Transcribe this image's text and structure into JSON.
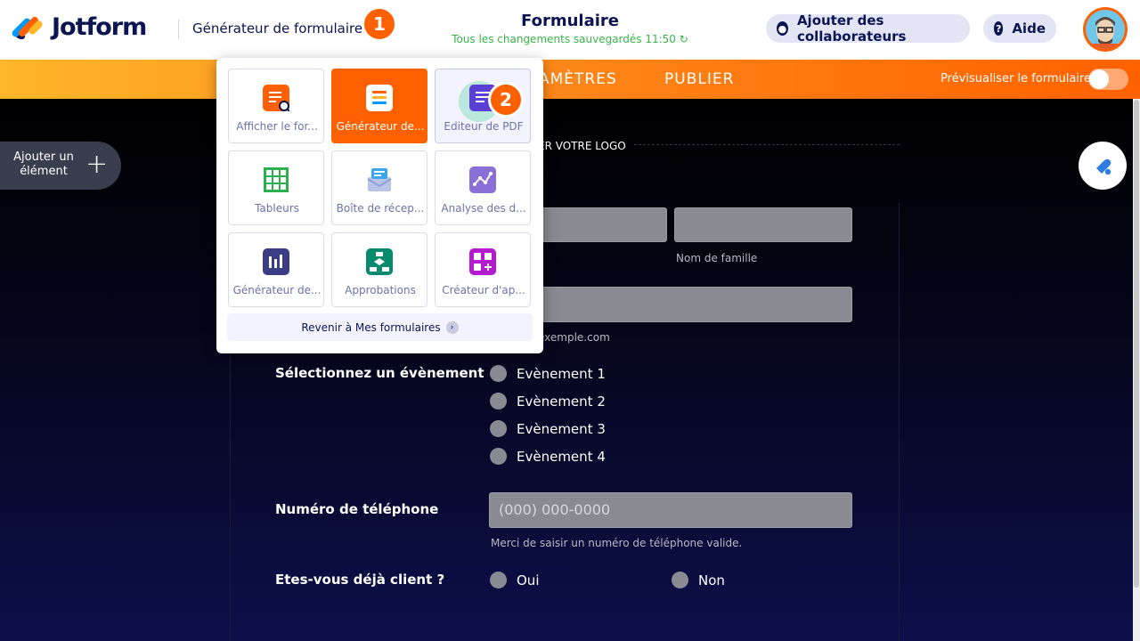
{
  "header": {
    "brand": "Jotform",
    "builder_menu": "Générateur de formulaires",
    "step1": "1",
    "form_title": "Formulaire",
    "save_status": "Tous les changements sauvegardés 11:50 ↻",
    "collaborators": "Ajouter des collaborateurs",
    "help": "Aide"
  },
  "nav": {
    "settings": "AMÈTRES",
    "publish": "PUBLIER",
    "preview": "Prévisualiser le formulaire"
  },
  "dropdown": {
    "tiles": [
      {
        "label": "Afficher le for...",
        "icon": "form-view-icon",
        "color": "#ff6100"
      },
      {
        "label": "Générateur de...",
        "icon": "form-builder-icon",
        "color": "#ff6100"
      },
      {
        "label": "Editeur de PDF",
        "icon": "pdf-editor-icon",
        "color": "#5b3fd4"
      },
      {
        "label": "Tableurs",
        "icon": "tables-icon",
        "color": "#2db050"
      },
      {
        "label": "Boîte de récep...",
        "icon": "inbox-icon",
        "color": "#39a8e8"
      },
      {
        "label": "Analyse des d...",
        "icon": "analytics-icon",
        "color": "#8b6fd8"
      },
      {
        "label": "Générateur de...",
        "icon": "report-builder-icon",
        "color": "#3b3d85"
      },
      {
        "label": "Approbations",
        "icon": "approvals-icon",
        "color": "#078a6e"
      },
      {
        "label": "Créateur d'ap...",
        "icon": "app-builder-icon",
        "color": "#b61ad0"
      }
    ],
    "back_link": "Revenir à Mes formulaires",
    "step2": "2"
  },
  "canvas": {
    "add_element": "Ajouter un élément",
    "logo_hint": "ER VOTRE LOGO",
    "last_name_label": "Nom de famille",
    "email_hint": "exemple.com",
    "event_label": "Sélectionnez un évènement",
    "events": [
      "Evènement 1",
      "Evènement 2",
      "Evènement 3",
      "Evènement 4"
    ],
    "phone_label": "Numéro de téléphone",
    "phone_placeholder": "(000) 000-0000",
    "phone_hint": "Merci de saisir un numéro de téléphone valide.",
    "client_label": "Etes-vous déjà client ?",
    "client_yes": "Oui",
    "client_no": "Non"
  },
  "colors": {
    "accent": "#ff6100",
    "navy": "#0a1551",
    "saved_green": "#39b54a"
  }
}
